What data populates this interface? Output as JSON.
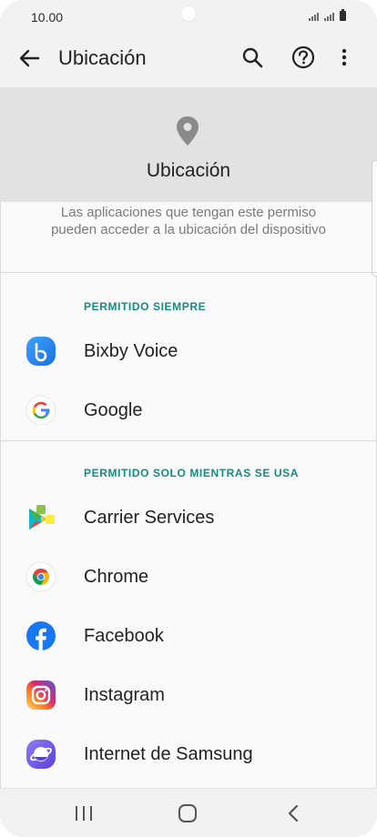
{
  "status_bar": {
    "time": "10.00"
  },
  "app_bar": {
    "title": "Ubicación"
  },
  "hero": {
    "title": "Ubicación"
  },
  "description": "Las aplicaciones que tengan este permiso pueden acceder a la ubicación del dispositivo",
  "sections": [
    {
      "header": "PERMITIDO SIEMPRE",
      "apps": [
        {
          "label": "Bixby Voice",
          "icon": "bixby-voice-icon"
        },
        {
          "label": "Google",
          "icon": "google-icon"
        }
      ]
    },
    {
      "header": "PERMITIDO SOLO MIENTRAS SE USA",
      "apps": [
        {
          "label": "Carrier Services",
          "icon": "carrier-services-icon"
        },
        {
          "label": "Chrome",
          "icon": "chrome-icon"
        },
        {
          "label": "Facebook",
          "icon": "facebook-icon"
        },
        {
          "label": "Instagram",
          "icon": "instagram-icon"
        },
        {
          "label": "Internet de Samsung",
          "icon": "samsung-internet-icon"
        }
      ]
    }
  ],
  "colors": {
    "accent": "#1a8a7d",
    "hero_bg": "#e2e2e2",
    "app_bar_bg": "#f2f2f2"
  }
}
